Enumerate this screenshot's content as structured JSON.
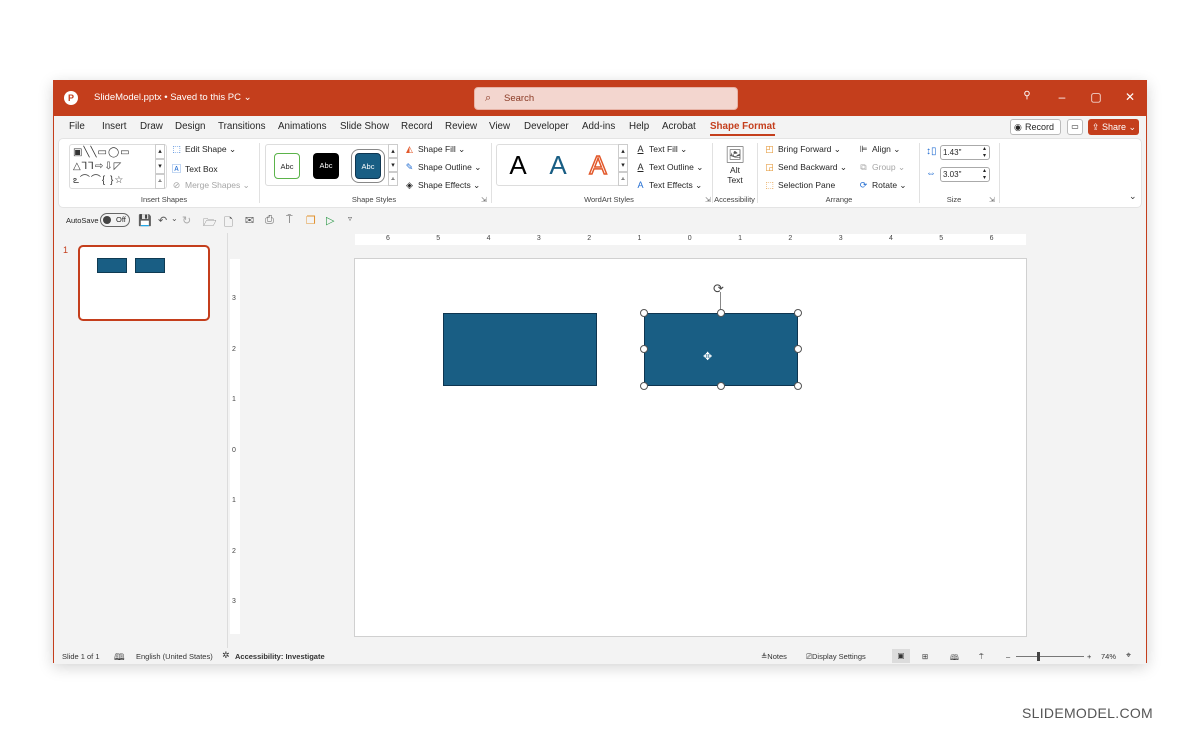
{
  "titlebar": {
    "app_icon": "powerpoint-logo-icon",
    "doc_title": "SlideModel.pptx • Saved to this PC ⌄",
    "search_placeholder": "Search",
    "controls": {
      "lightbulb": "💡",
      "minimize": "–",
      "maximize": "▢",
      "close": "✕"
    }
  },
  "menu": {
    "tabs": [
      "File",
      "Insert",
      "Draw",
      "Design",
      "Transitions",
      "Animations",
      "Slide Show",
      "Record",
      "Review",
      "View",
      "Developer",
      "Add-ins",
      "Help",
      "Acrobat",
      "Shape Format"
    ],
    "active_tab": "Shape Format",
    "record_label": "Record",
    "share_label": "Share ⌄",
    "accent_color": "#c43e1c"
  },
  "ribbon": {
    "insert_shapes": {
      "label": "Insert Shapes",
      "gallery_rows": [
        "▣╲╲▭◯▭",
        "△⅂⅂⇨⇩◸",
        "ఽ⌒⌒{ }☆"
      ],
      "edit_shape": "Edit Shape ⌄",
      "text_box": "Text Box",
      "merge_shapes": "Merge Shapes ⌄"
    },
    "shape_styles": {
      "label": "Shape Styles",
      "samples": [
        "Abc",
        "Abc",
        "Abc"
      ],
      "shape_fill": "Shape Fill ⌄",
      "shape_outline": "Shape Outline ⌄",
      "shape_effects": "Shape Effects ⌄"
    },
    "wordart_styles": {
      "label": "WordArt Styles",
      "samples": [
        "A",
        "A",
        "A"
      ],
      "text_fill": "Text Fill ⌄",
      "text_outline": "Text Outline ⌄",
      "text_effects": "Text Effects ⌄"
    },
    "accessibility": {
      "label": "Accessibility",
      "alt_text_1": "Alt",
      "alt_text_2": "Text"
    },
    "arrange": {
      "label": "Arrange",
      "bring_forward": "Bring Forward ⌄",
      "send_backward": "Send Backward ⌄",
      "selection_pane": "Selection Pane",
      "align": "Align ⌄",
      "group": "Group ⌄",
      "rotate": "Rotate ⌄"
    },
    "size": {
      "label": "Size",
      "height": "1.43\"",
      "width": "3.03\""
    }
  },
  "qat": {
    "autosave_label": "AutoSave",
    "autosave_state": "Off",
    "icons": [
      "💾",
      "↶",
      "⌄",
      "↻",
      "🗁",
      "🗋",
      "✉",
      "⎙",
      "⍑",
      "❐",
      "▷",
      "▿"
    ]
  },
  "thumbnails": [
    {
      "number": "1"
    }
  ],
  "rulers": {
    "horizontal": [
      "6",
      "5",
      "4",
      "3",
      "2",
      "1",
      "0",
      "1",
      "2",
      "3",
      "4",
      "5",
      "6"
    ],
    "vertical": [
      "3",
      "2",
      "1",
      "0",
      "1",
      "2",
      "3"
    ]
  },
  "slide": {
    "shape_color": "#195e84",
    "shapes": [
      {
        "name": "rectangle-1",
        "selected": false
      },
      {
        "name": "rectangle-2",
        "selected": true
      }
    ]
  },
  "statusbar": {
    "slide_info": "Slide 1 of 1",
    "language": "English (United States)",
    "accessibility": "Accessibility: Investigate",
    "notes": "Notes",
    "display_settings": "Display Settings",
    "zoom_level": "74%"
  },
  "watermark": "SLIDEMODEL.COM"
}
